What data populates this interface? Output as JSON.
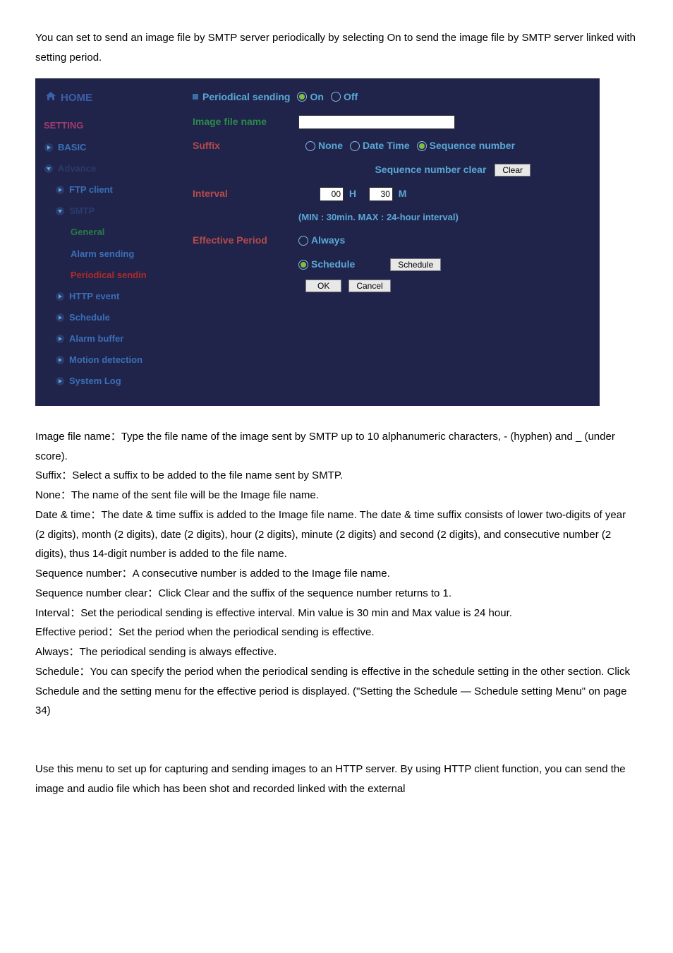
{
  "intro": "You can set to send an image file by SMTP server periodically by selecting On to send the image file by SMTP server linked with setting period.",
  "sidebar": {
    "home": "HOME",
    "setting": "SETTING",
    "items": [
      {
        "label": "BASIC"
      },
      {
        "label": "Advance"
      },
      {
        "label": "FTP client"
      },
      {
        "label": "SMTP"
      },
      {
        "label": "General"
      },
      {
        "label": "Alarm sending"
      },
      {
        "label": "Periodical sendin"
      },
      {
        "label": "HTTP event"
      },
      {
        "label": "Schedule"
      },
      {
        "label": "Alarm buffer"
      },
      {
        "label": "Motion detection"
      },
      {
        "label": "System Log"
      }
    ]
  },
  "panel": {
    "header": "Periodical sending",
    "on": "On",
    "off": "Off",
    "image_file_name": "Image file name",
    "suffix": "Suffix",
    "none": "None",
    "date_time": "Date Time",
    "seq_num": "Sequence number",
    "seq_clear_label": "Sequence number clear",
    "clear_btn": "Clear",
    "interval": "Interval",
    "h_val": "00",
    "h_label": "H",
    "m_val": "30",
    "m_label": "M",
    "interval_hint": "(MIN : 30min. MAX : 24-hour interval)",
    "effective_period": "Effective Period",
    "always": "Always",
    "schedule": "Schedule",
    "schedule_btn": "Schedule",
    "ok": "OK",
    "cancel": "Cancel"
  },
  "desc": {
    "p1": "Image file name：Type the file name of the image sent by SMTP up to 10 alphanumeric characters, - (hyphen) and _ (under score).",
    "p2": "Suffix：Select a suffix to be added to the file name sent by SMTP.",
    "p3": "None：The name of the sent file will be the Image file name.",
    "p4": "Date & time：The date & time suffix is added to the Image file name. The date & time suffix consists of lower two-digits of year (2 digits), month (2 digits), date (2 digits), hour (2 digits), minute (2 digits) and second (2 digits), and consecutive number (2 digits), thus 14-digit number is added to the file name.",
    "p5": "Sequence number：A consecutive number is added to the Image file name.",
    "p6": "Sequence number clear：Click Clear and the suffix of the sequence number returns to 1.",
    "p7": "Interval：Set the periodical sending is effective interval. Min value is 30 min and Max value is 24 hour.",
    "p8": "Effective period：Set the period when the periodical sending is effective.",
    "p9": "Always：The periodical sending is always effective.",
    "p10": "Schedule：You can specify the period when the periodical sending is effective in the schedule setting in the other section. Click Schedule and the setting menu for the effective period is displayed. (\"Setting the Schedule — Schedule setting Menu\" on page 34)",
    "p11": "Use this menu to set up for capturing and sending images to an HTTP server. By using HTTP client function, you can send the image and audio file which has been shot and recorded linked with the external"
  }
}
